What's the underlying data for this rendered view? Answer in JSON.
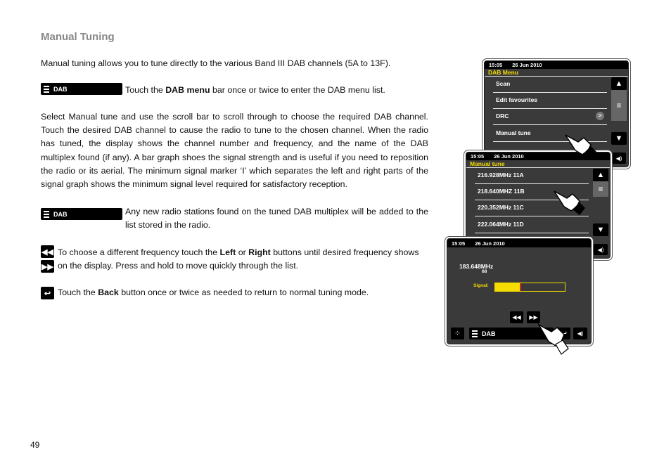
{
  "page": {
    "title": "Manual Tuning",
    "intro": "Manual tuning allows you to tune directly to the various Band III DAB channels (5A to 13F).",
    "dab_menu_instruction": {
      "pre": "Touch the ",
      "bold": "DAB menu",
      "post": " bar once or twice to enter the DAB menu list."
    },
    "select_paragraph": "Select Manual tune and use the scroll bar to scroll through to choose the required DAB channel. Touch the desired DAB channel to cause the radio to tune to the chosen channel. When the radio has tuned, the display shows the channel number and frequency, and the name of the DAB multiplex found (if any). A bar graph shoes the signal strength and is useful if you need to reposition the radio or its aerial. The minimum signal marker ‘I’ which separates the left and right parts of the signal graph shows the minimum signal level required for satisfactory reception.",
    "new_stations_text": "Any new radio stations found on the tuned DAB multiplex will be added to the list stored in the radio.",
    "leftright_text": {
      "pre": "To choose a different frequency touch the ",
      "b1": "Left",
      "mid": " or ",
      "b2": "Right",
      "post": " buttons until desired frequency shows",
      "line2": "on the display. Press and hold to move quickly through the list."
    },
    "back_text": {
      "pre": "Touch the ",
      "bold": "Back",
      "post": " button once or twice as needed to return to normal tuning mode."
    },
    "dab_bar_label": "DAB",
    "page_number": "49"
  },
  "icons": {
    "rewind": "◀◀",
    "forward": "▶▶",
    "back": "↩"
  },
  "screens": {
    "time": "15:05",
    "date": "26 Jun 2010",
    "dab_menu": {
      "title": "DAB Menu",
      "items": [
        "Scan",
        "Edit favourites",
        "DRC",
        "Manual tune"
      ]
    },
    "manual_tune": {
      "title": "Manual tune",
      "items": [
        "216.928MHz 11A",
        "218.640MHZ 11B",
        "220.352MHz 11C",
        "222.064MHz 11D"
      ]
    },
    "tuned": {
      "frequency": "183.648MHz",
      "channel": "68",
      "signal_label": "Signal:",
      "signal_level_fraction": 0.35,
      "bottom_label": "DAB"
    }
  },
  "colors": {
    "accent_yellow": "#f5dd00",
    "signal_marker": "#e02020",
    "screen_bg": "#3a3a3a"
  }
}
